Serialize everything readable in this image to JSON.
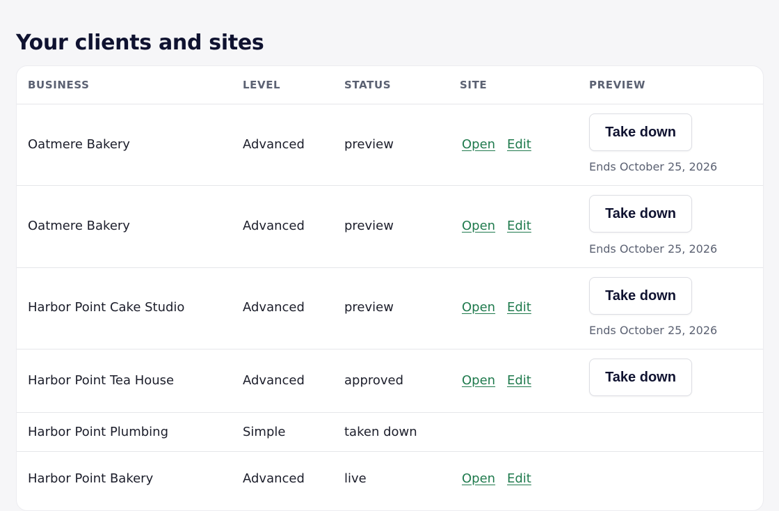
{
  "page": {
    "title": "Your clients and sites"
  },
  "table": {
    "headers": {
      "business": "BUSINESS",
      "level": "LEVEL",
      "status": "STATUS",
      "site": "SITE",
      "preview": "PREVIEW"
    },
    "rows": [
      {
        "business": "Oatmere Bakery",
        "level": "Advanced",
        "status": "preview",
        "open_label": "Open",
        "edit_label": "Edit",
        "action_label": "Take down",
        "ends_text": "Ends October 25, 2026"
      },
      {
        "business": "Oatmere Bakery",
        "level": "Advanced",
        "status": "preview",
        "open_label": "Open",
        "edit_label": "Edit",
        "action_label": "Take down",
        "ends_text": "Ends October 25, 2026"
      },
      {
        "business": "Harbor Point Cake Studio",
        "level": "Advanced",
        "status": "preview",
        "open_label": "Open",
        "edit_label": "Edit",
        "action_label": "Take down",
        "ends_text": "Ends October 25, 2026"
      },
      {
        "business": "Harbor Point Tea House",
        "level": "Advanced",
        "status": "approved",
        "open_label": "Open",
        "edit_label": "Edit",
        "action_label": "Take down"
      },
      {
        "business": "Harbor Point Plumbing",
        "level": "Simple",
        "status": "taken down"
      },
      {
        "business": "Harbor Point Bakery",
        "level": "Advanced",
        "status": "live",
        "open_label": "Open",
        "edit_label": "Edit"
      }
    ]
  },
  "colors": {
    "link": "#1f7a4d",
    "page_background": "#f6f6f8",
    "title": "#0f1230",
    "header_text": "#5b6172"
  }
}
